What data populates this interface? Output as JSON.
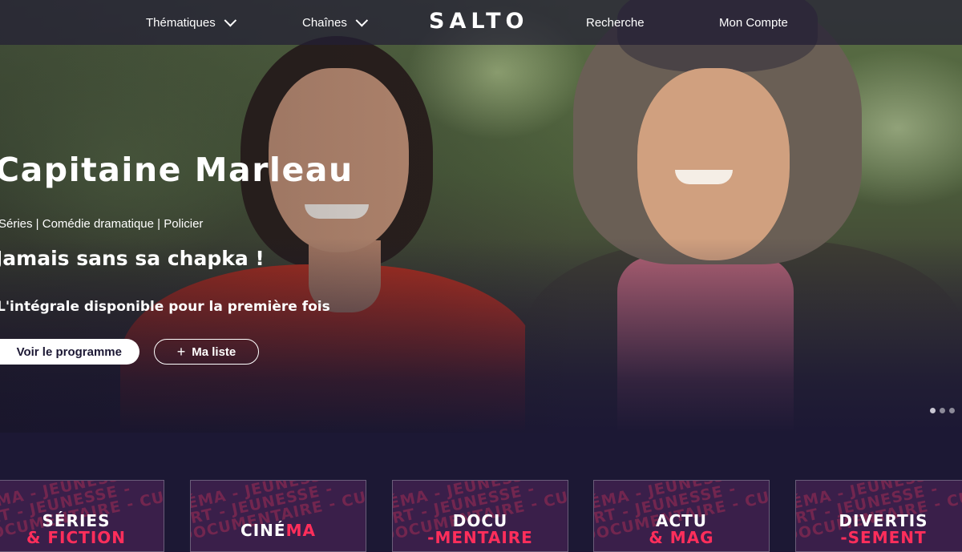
{
  "header": {
    "nav_thematiques": "Thématiques",
    "nav_chaines": "Chaînes",
    "logo": "SALTO",
    "nav_recherche": "Recherche",
    "nav_compte": "Mon Compte"
  },
  "hero": {
    "title": "Capitaine Marleau",
    "genres": "Séries | Comédie dramatique | Policier",
    "tagline": "Jamais sans sa chapka !",
    "description": "L'intégrale disponible pour la première fois",
    "primary_button": "Voir le programme",
    "secondary_button": "Ma liste",
    "plus_icon": "+",
    "carousel_dots": 3,
    "active_dot": 1
  },
  "categories": [
    {
      "line1": "SÉRIES",
      "line2": "& FICTION"
    },
    {
      "line1": "CINÉ",
      "line2": "MA",
      "inline": true
    },
    {
      "line1": "DOCU",
      "line2": "-MENTAIRE"
    },
    {
      "line1": "ACTU",
      "line2": "& MAG"
    },
    {
      "line1": "DIVERTIS",
      "line2": "-SEMENT"
    }
  ],
  "tile_pattern_text": [
    "NÉMA - JEUNESSE",
    "ORT - JEUNESSE -",
    "DOCUMENTAIRE - CU"
  ],
  "colors": {
    "background": "#1c1834",
    "accent": "#ff2e5b",
    "tile": "#3a1f4a"
  }
}
